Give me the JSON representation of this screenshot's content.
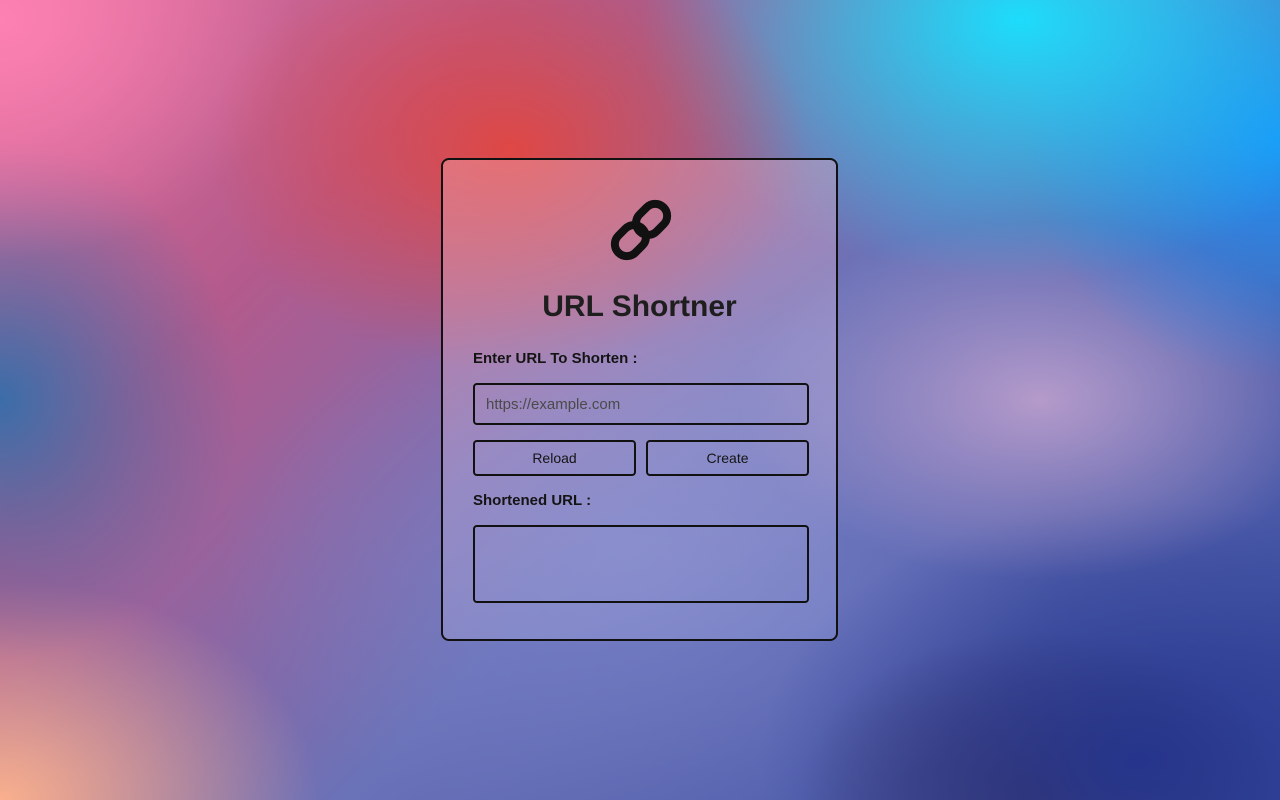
{
  "app": {
    "title": "URL Shortner",
    "logo_icon": "link-icon"
  },
  "form": {
    "input_label": "Enter URL To Shorten :",
    "input_placeholder": "https://example.com",
    "input_value": "",
    "reload_label": "Reload",
    "create_label": "Create",
    "result_label": "Shortened URL :",
    "result_value": ""
  },
  "colors": {
    "border": "#111111",
    "text": "#1e1e1e"
  }
}
